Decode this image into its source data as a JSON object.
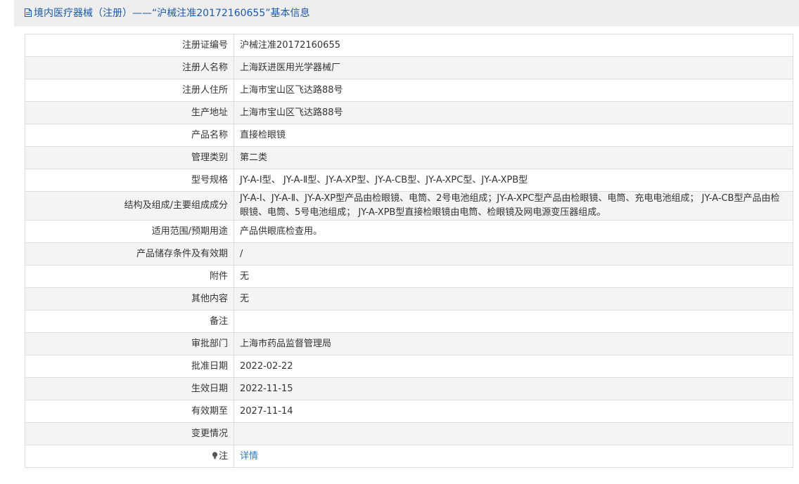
{
  "header": {
    "title": "境内医疗器械（注册）——“沪械注准20172160655”基本信息",
    "icon": "document-icon"
  },
  "rows": [
    {
      "label": "注册证编号",
      "value": "沪械注准20172160655"
    },
    {
      "label": "注册人名称",
      "value": "上海跃进医用光学器械厂"
    },
    {
      "label": "注册人住所",
      "value": "上海市宝山区飞达路88号"
    },
    {
      "label": "生产地址",
      "value": "上海市宝山区飞达路88号"
    },
    {
      "label": "产品名称",
      "value": "直接检眼镜"
    },
    {
      "label": "管理类别",
      "value": "第二类"
    },
    {
      "label": "型号规格",
      "value": "JY-A-Ⅰ型、 JY-A-Ⅱ型、JY-A-XP型、JY-A-CB型、JY-A-XPC型、JY-A-XPB型"
    },
    {
      "label": "结构及组成/主要组成成分",
      "value": "JY-A-Ⅰ、JY-A-Ⅱ、JY-A-XP型产品由检眼镜、电筒、2号电池组成；JY-A-XPC型产品由检眼镜、电筒、充电电池组成； JY-A-CB型产品由检眼镜、电筒、5号电池组成； JY-A-XPB型直接检眼镜由电筒、检眼镜及网电源变压器组成。"
    },
    {
      "label": "适用范围/预期用途",
      "value": "产品供眼底检查用。"
    },
    {
      "label": "产品储存条件及有效期",
      "value": "/"
    },
    {
      "label": "附件",
      "value": "无"
    },
    {
      "label": "其他内容",
      "value": "无"
    },
    {
      "label": "备注",
      "value": ""
    },
    {
      "label": "审批部门",
      "value": "上海市药品监督管理局"
    },
    {
      "label": "批准日期",
      "value": "2022-02-22"
    },
    {
      "label": "生效日期",
      "value": "2022-11-15"
    },
    {
      "label": "有效期至",
      "value": "2027-11-14"
    },
    {
      "label": "变更情况",
      "value": ""
    }
  ],
  "note_row": {
    "icon": "lightbulb-icon",
    "label": "注",
    "link_text": "详情"
  },
  "colors": {
    "title": "#1a5aa8",
    "link": "#2d7ac9",
    "header_bg": "#eeeeee",
    "row_alt": "#f4f4f4",
    "border": "#dcdcdc"
  }
}
